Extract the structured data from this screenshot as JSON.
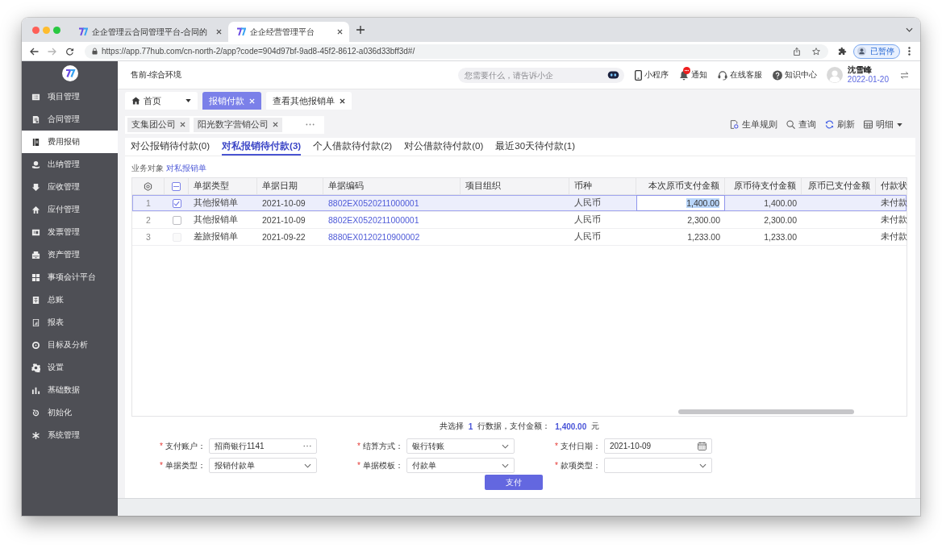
{
  "browser": {
    "tabs": [
      {
        "title": "企企管理云合同管理平台-合同的",
        "selected": false
      },
      {
        "title": "企企经营管理平台",
        "selected": true
      }
    ],
    "url": "https://app.77hub.com/cn-north-2/app?code=904d97bf-9ad8-45f2-8612-a036d33bff3d#/",
    "profile": "已暂停"
  },
  "sidebar": {
    "items": [
      {
        "label": "项目管理",
        "selected": false
      },
      {
        "label": "合同管理",
        "selected": false
      },
      {
        "label": "费用报销",
        "selected": true
      },
      {
        "label": "出纳管理",
        "selected": false
      },
      {
        "label": "应收管理",
        "selected": false
      },
      {
        "label": "应付管理",
        "selected": false
      },
      {
        "label": "发票管理",
        "selected": false
      },
      {
        "label": "资产管理",
        "selected": false
      },
      {
        "label": "事项会计平台",
        "selected": false
      },
      {
        "label": "总账",
        "selected": false
      },
      {
        "label": "报表",
        "selected": false
      },
      {
        "label": "目标及分析",
        "selected": false
      },
      {
        "label": "设置",
        "selected": false
      },
      {
        "label": "基础数据",
        "selected": false
      },
      {
        "label": "初始化",
        "selected": false
      },
      {
        "label": "系统管理",
        "selected": false
      }
    ]
  },
  "header": {
    "environment": "售前-综合环境",
    "search": {
      "placeholder": "您需要什么，请告诉小企"
    },
    "actions": [
      {
        "kind": "miniapp",
        "label": "小程序",
        "unread": false
      },
      {
        "kind": "notice",
        "label": "通知",
        "unread": true
      },
      {
        "kind": "service",
        "label": "在线客服",
        "unread": false
      },
      {
        "kind": "help",
        "label": "知识中心",
        "unread": false
      }
    ],
    "user": {
      "name": "沈雪峰",
      "date": "2022-01-20"
    }
  },
  "page_tabs": [
    {
      "kind": "home",
      "label": "首页",
      "selected": false,
      "closable": false
    },
    {
      "kind": "page",
      "label": "报销付款",
      "selected": true,
      "closable": true
    },
    {
      "kind": "page",
      "label": "查看其他报销单",
      "selected": false,
      "closable": true
    }
  ],
  "company_tags": [
    {
      "label": "支集团公司"
    },
    {
      "label": "阳光数字营销公司"
    }
  ],
  "toolbar": [
    {
      "kind": "rules",
      "label": "生单规则"
    },
    {
      "kind": "search",
      "label": "查询"
    },
    {
      "kind": "refresh",
      "label": "刷新"
    },
    {
      "kind": "view",
      "label": "明细"
    }
  ],
  "subtabs": [
    {
      "label": "对公报销待付款(0)",
      "selected": false
    },
    {
      "label": "对私报销待付款(3)",
      "selected": true
    },
    {
      "label": "个人借款待付款(2)",
      "selected": false
    },
    {
      "label": "对公借款待付款(0)",
      "selected": false
    },
    {
      "label": "最近30天待付款(1)",
      "selected": false
    }
  ],
  "business_object": {
    "label": "业务对象",
    "value": "对私报销单"
  },
  "table": {
    "indeterminate": true,
    "columns": [
      "单据类型",
      "单据日期",
      "单据编码",
      "项目组织",
      "币种",
      "本次原币支付金额",
      "原币待支付金额",
      "原币已支付金额",
      "付款状"
    ],
    "rows": [
      {
        "number": "1",
        "selected": true,
        "checked": true,
        "disabled": false,
        "type": "其他报销单",
        "date": "2021-10-09",
        "code": "8802EX0520211000001",
        "currency": "人民币",
        "amount": "1,400.00",
        "pending": "1,400.00",
        "status": "未付款"
      },
      {
        "number": "2",
        "selected": false,
        "checked": false,
        "disabled": false,
        "type": "其他报销单",
        "date": "2021-10-09",
        "code": "8802EX0520211000001",
        "currency": "人民币",
        "amount": "2,300.00",
        "pending": "2,300.00",
        "status": "未付款"
      },
      {
        "number": "3",
        "selected": false,
        "checked": false,
        "disabled": true,
        "type": "差旅报销单",
        "date": "2021-09-22",
        "code": "8880EX0120210900002",
        "currency": "人民币",
        "amount": "1,233.00",
        "pending": "1,233.00",
        "status": "未付款"
      }
    ]
  },
  "summary": {
    "prefix": "共选择",
    "count": "1",
    "middle": "行数据，支付金额：",
    "amount": "1,400.00",
    "suffix": "元"
  },
  "form": {
    "fields": [
      {
        "kind": "lookup",
        "required_mark": "*",
        "label": "支付账户：",
        "value": "招商银行1141"
      },
      {
        "kind": "select",
        "required_mark": "*",
        "label": "结算方式：",
        "value": "银行转账"
      },
      {
        "kind": "date",
        "required_mark": "*",
        "label": "支付日期：",
        "value": "2021-10-09"
      },
      {
        "kind": "select",
        "required_mark": "*",
        "label": "单据类型：",
        "value": "报销付款单"
      },
      {
        "kind": "select",
        "required_mark": "*",
        "label": "单据模板：",
        "value": "付款单"
      },
      {
        "kind": "select",
        "required_mark": "*",
        "label": "款项类型："
      }
    ],
    "submit": "支付"
  }
}
